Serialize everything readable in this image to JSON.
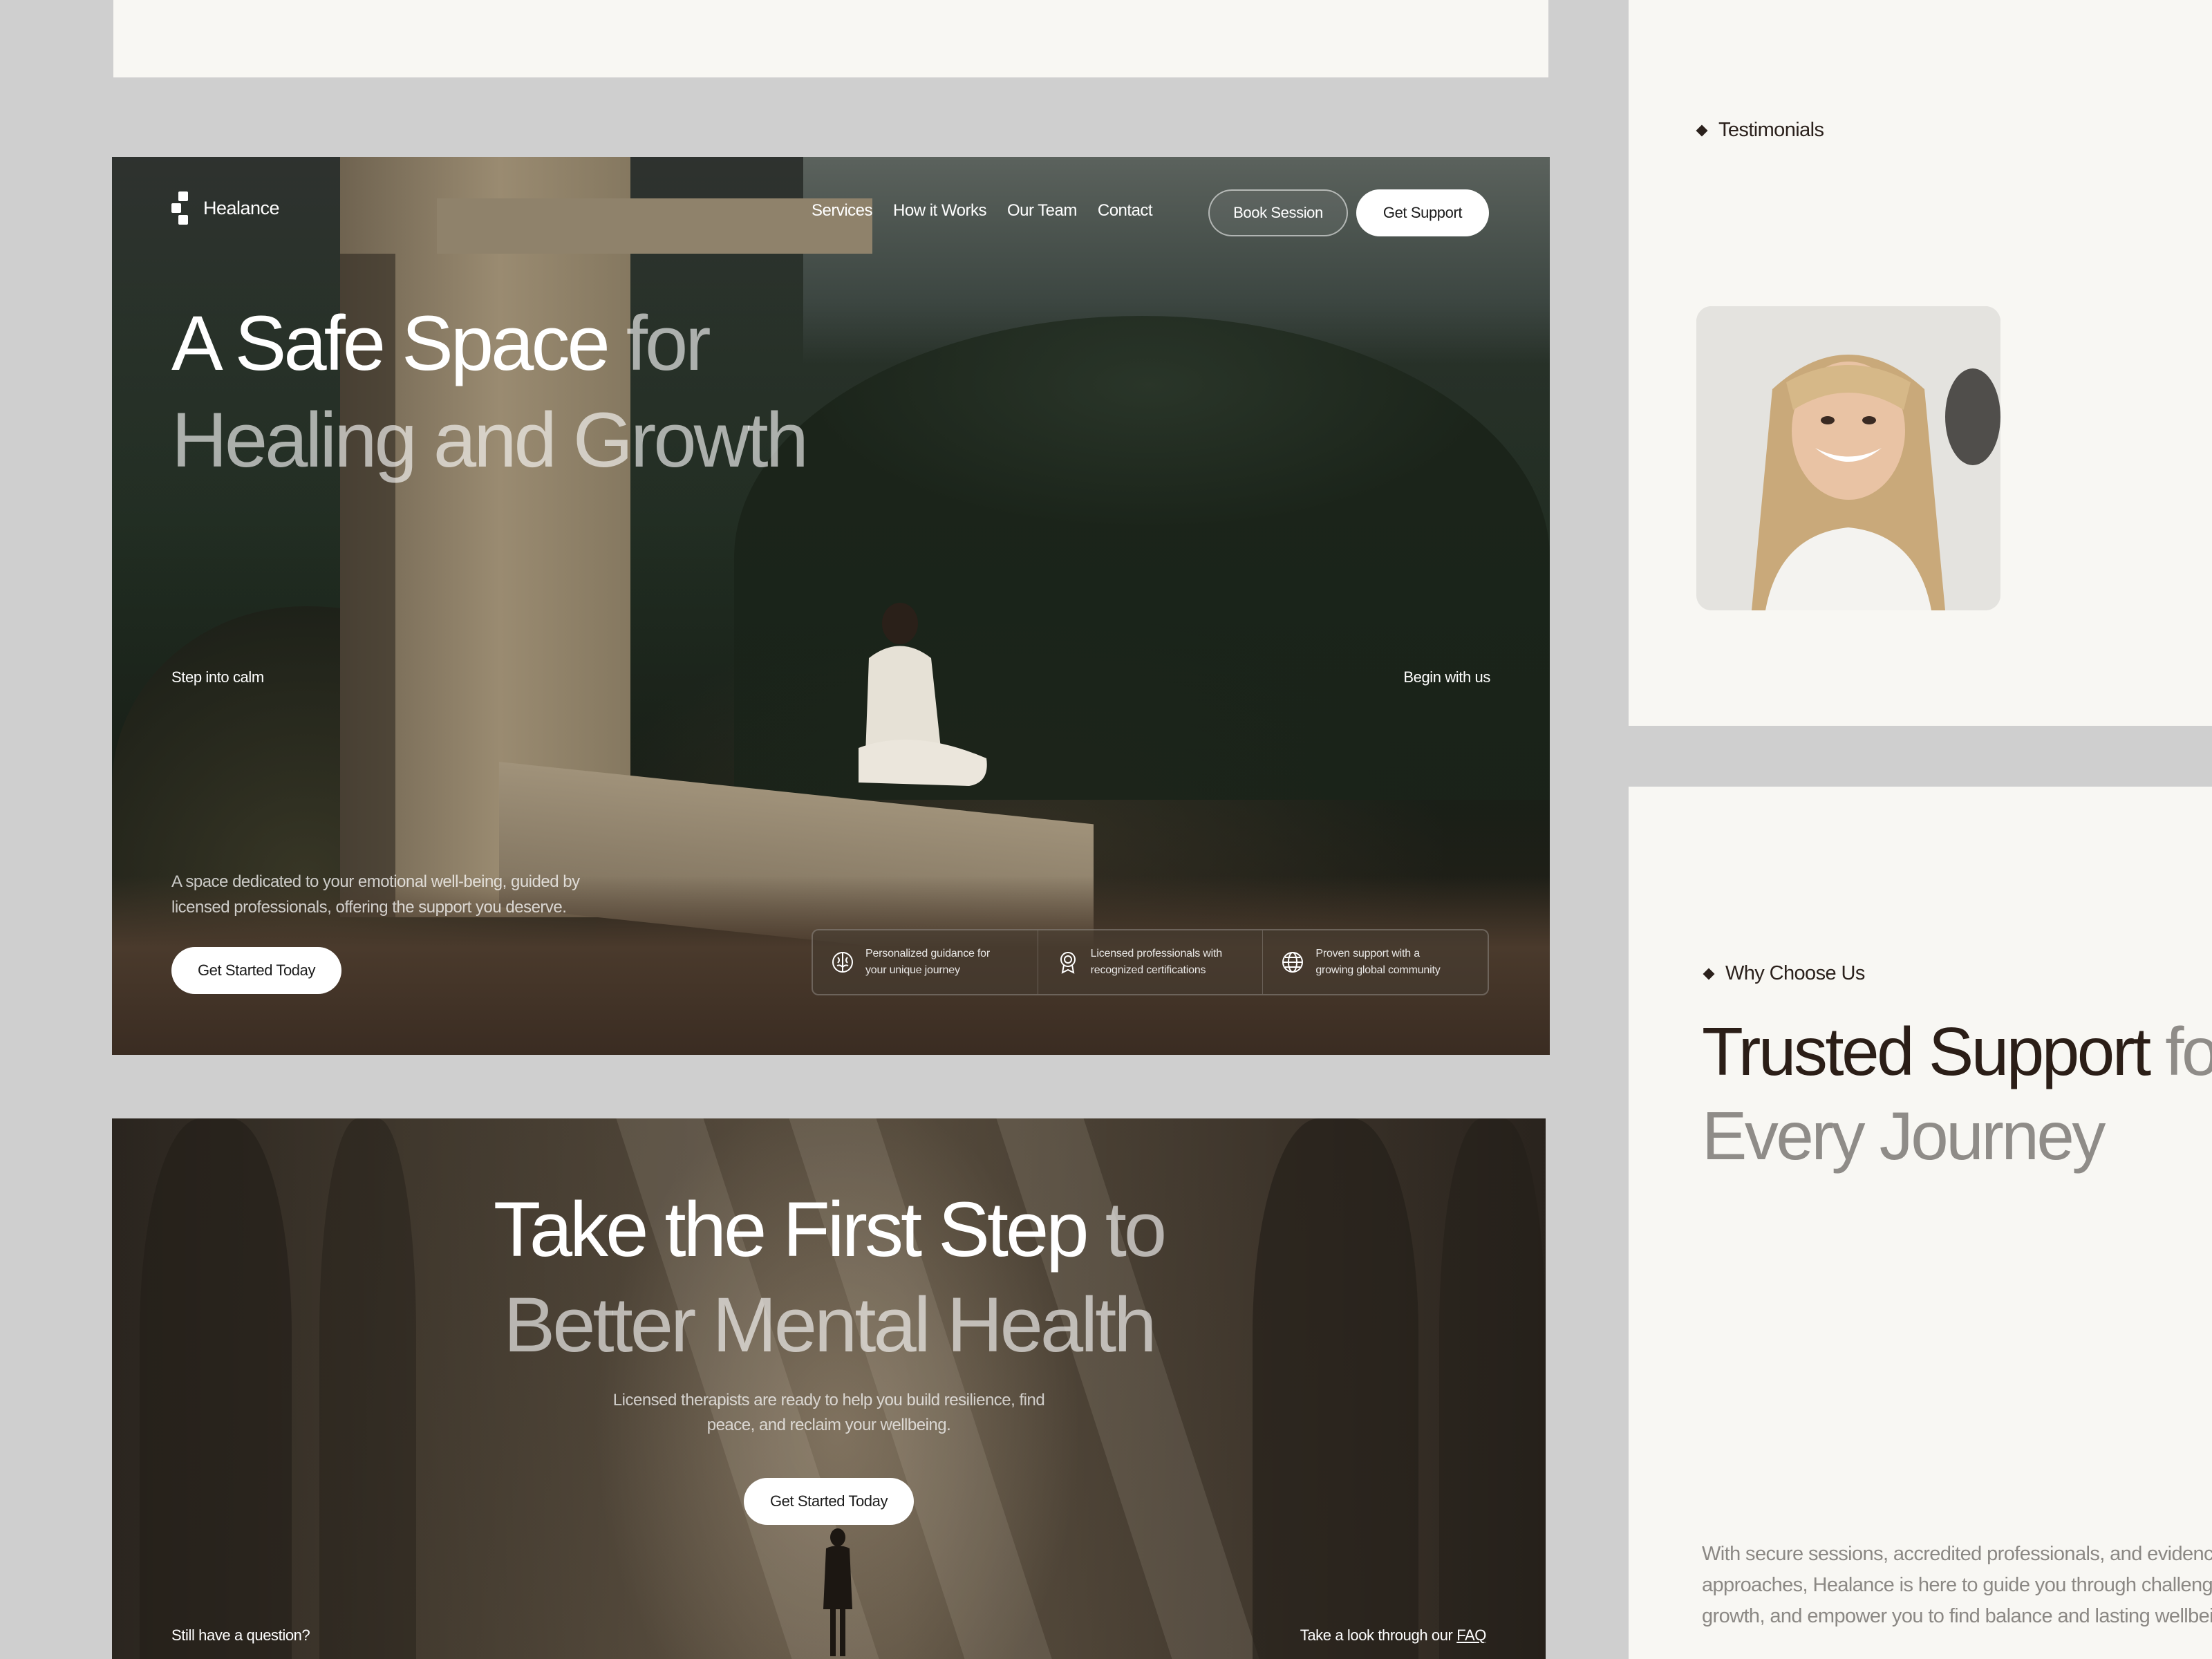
{
  "brand": {
    "name": "Healance"
  },
  "nav": {
    "items": [
      "Services",
      "How it Works",
      "Our Team",
      "Contact"
    ]
  },
  "header_buttons": {
    "book": "Book Session",
    "support": "Get Support"
  },
  "hero": {
    "title_main": "A Safe Space",
    "title_dim_1": " for",
    "title_dim_2": "Healing and Growth",
    "left_tag": "Step into calm",
    "right_tag": "Begin with us",
    "description": "A space dedicated to your emotional well-being, guided by licensed professionals, offering the support you deserve.",
    "cta": "Get Started Today",
    "features": [
      {
        "icon": "brain-icon",
        "line1": "Personalized guidance for",
        "line2": "your unique journey"
      },
      {
        "icon": "award-icon",
        "line1": "Licensed professionals with",
        "line2": "recognized certifications"
      },
      {
        "icon": "globe-icon",
        "line1": "Proven support with a",
        "line2": "growing global community"
      }
    ]
  },
  "cta_section": {
    "title_main": "Take the First Step",
    "title_dim_1": " to",
    "title_dim_2": "Better Mental Health",
    "description_1": "Licensed therapists are ready to help you build resilience, find",
    "description_2": "peace, and reclaim your wellbeing.",
    "button": "Get Started Today",
    "question": "Still have a question?",
    "faq_prefix": "Take a look through our ",
    "faq_link": "FAQ"
  },
  "testimonials": {
    "tag": "Testimonials"
  },
  "why": {
    "tag": "Why Choose Us",
    "title_main": "Trusted Support",
    "title_dim_1": " for",
    "title_dim_2": "Every Journey",
    "desc_1": "With secure sessions, accredited professionals, and evidence-based",
    "desc_2": "approaches, Healance is here to guide you through challenges, foster",
    "desc_3": "growth, and empower you to find balance and lasting wellbeing."
  },
  "colors": {
    "accent_dark": "#2b1e17",
    "muted": "#8f8c88",
    "card_bg": "#f8f7f3",
    "canvas": "#cfcfcf"
  }
}
